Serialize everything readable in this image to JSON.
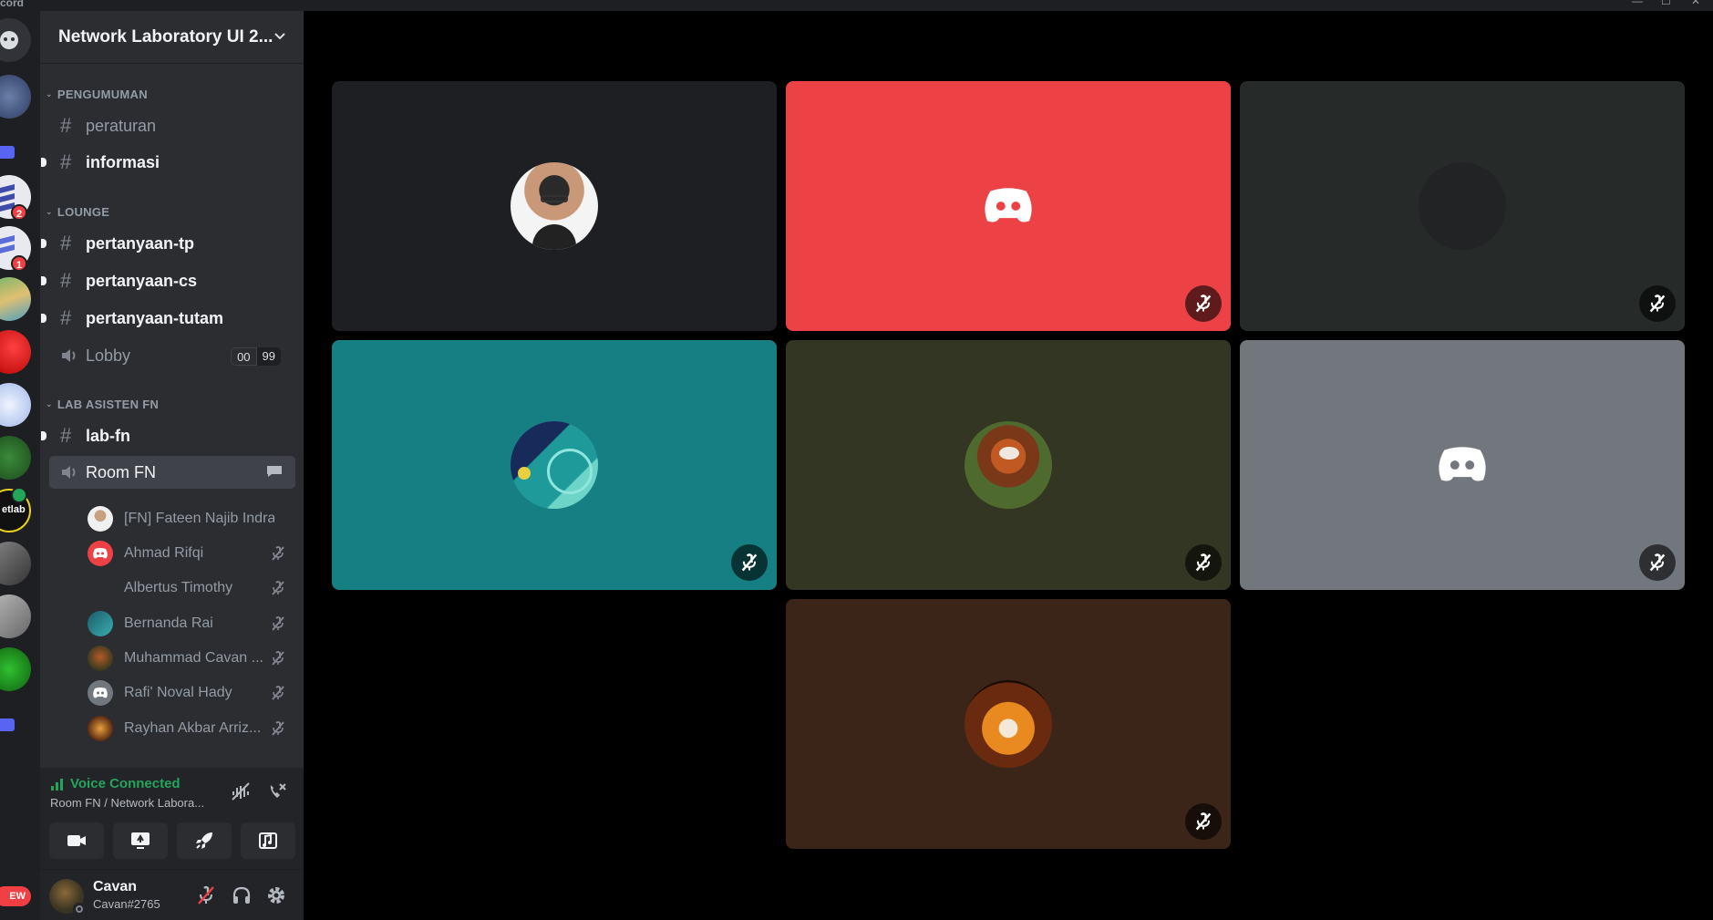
{
  "window": {
    "app_name": "cord",
    "controls": [
      "—",
      "☐",
      "✕"
    ]
  },
  "server_rail": {
    "badges": [
      "2",
      "1"
    ],
    "new_label": "EW",
    "elab_label": "etlab"
  },
  "server": {
    "name": "Network Laboratory UI 2..."
  },
  "categories": [
    {
      "name": "PENGUMUMAN"
    },
    {
      "name": "LOUNGE"
    },
    {
      "name": "LAB ASISTEN FN"
    }
  ],
  "channels": {
    "peraturan": "peraturan",
    "informasi": "informasi",
    "pertanyaan_tp": "pertanyaan-tp",
    "pertanyaan_cs": "pertanyaan-cs",
    "pertanyaan_tutam": "pertanyaan-tutam",
    "lobby": "Lobby",
    "lobby_count_a": "00",
    "lobby_count_b": "99",
    "lab_fn": "lab-fn",
    "room_fn": "Room FN"
  },
  "voice_users": [
    {
      "name": "[FN] Fateen Najib Indra..."
    },
    {
      "name": "Ahmad Rifqi"
    },
    {
      "name": "Albertus Timothy"
    },
    {
      "name": "Bernanda Rai"
    },
    {
      "name": "Muhammad Cavan ..."
    },
    {
      "name": "Rafi' Noval Hady"
    },
    {
      "name": "Rayhan Akbar Arriz..."
    }
  ],
  "voice_panel": {
    "status": "Voice Connected",
    "location": "Room FN / Network Labora..."
  },
  "user": {
    "name": "Cavan",
    "tag": "Cavan#2765"
  },
  "colors": {
    "tile_1": "#1e1f22",
    "tile_2": "#ed4245",
    "tile_3": "#262b29",
    "tile_4": "#167f84",
    "tile_5": "#333622",
    "tile_6": "#72767d",
    "tile_7": "#3b2418",
    "connected": "#23a55a"
  },
  "tiles_icons": [
    "person-avatar",
    "discord-logo-avatar",
    "blank-avatar",
    "abstract-avatar",
    "red-panda-avatar",
    "discord-logo-avatar",
    "dragon-avatar"
  ]
}
